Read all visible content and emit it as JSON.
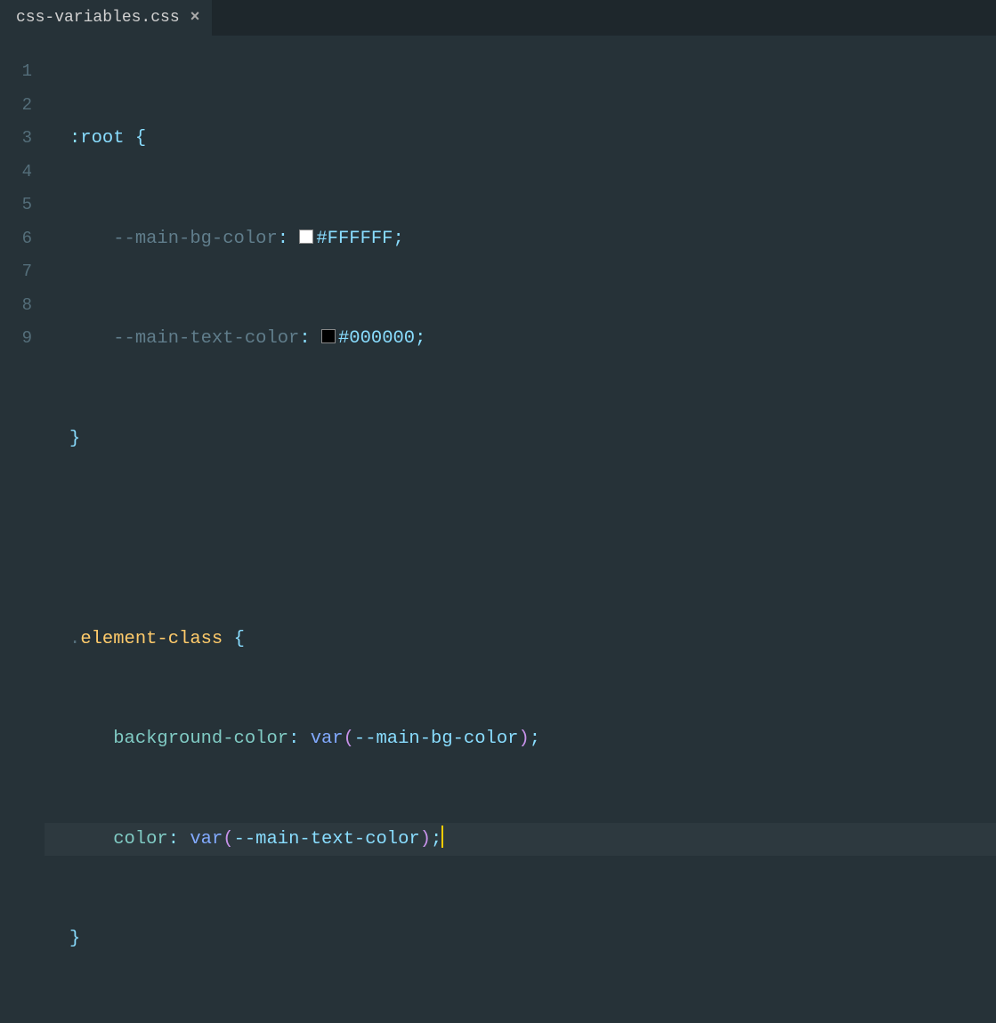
{
  "tab": {
    "filename": "css-variables.css",
    "close": "×"
  },
  "gutter": [
    "1",
    "2",
    "3",
    "4",
    "5",
    "6",
    "7",
    "8",
    "9"
  ],
  "code": {
    "l1": {
      "pseudo": ":root",
      "brace": "{"
    },
    "l2": {
      "prop": "--main-bg-color",
      "colon": ":",
      "hex": "#FFFFFF",
      "semi": ";"
    },
    "l3": {
      "prop": "--main-text-color",
      "colon": ":",
      "hex": "#000000",
      "semi": ";"
    },
    "l4": {
      "brace": "}"
    },
    "l6": {
      "dot": ".",
      "selector": "element-class",
      "brace": "{"
    },
    "l7": {
      "prop": "background-color",
      "colon": ":",
      "func": "var",
      "lp": "(",
      "arg": "--main-bg-color",
      "rp": ")",
      "semi": ";"
    },
    "l8": {
      "prop": "color",
      "colon": ":",
      "func": "var",
      "lp": "(",
      "arg": "--main-text-color",
      "rp": ")",
      "semi": ";"
    },
    "l9": {
      "brace": "}"
    }
  },
  "colors": {
    "swatch_white": "#FFFFFF",
    "swatch_black": "#000000"
  }
}
